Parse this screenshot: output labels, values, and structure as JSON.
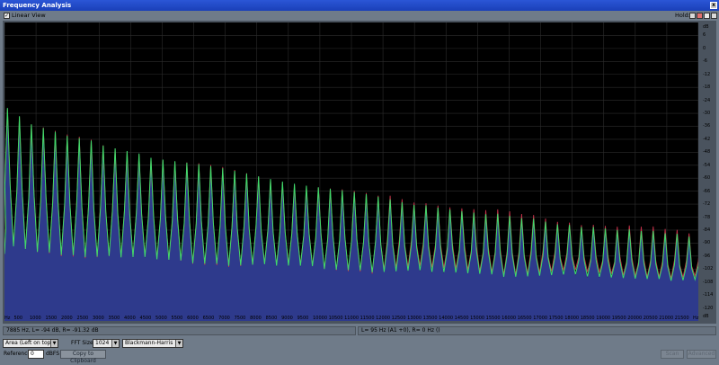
{
  "window": {
    "title": "Frequency Analysis",
    "close_glyph": "x"
  },
  "toolbar": {
    "linear_view_label": "Linear View",
    "linear_view_checked": true,
    "hold_label": "Hold:"
  },
  "hold_buttons": [
    {
      "name": "hold-button-1",
      "color": "#d9d9d9"
    },
    {
      "name": "hold-button-2",
      "color": "#e07070"
    },
    {
      "name": "hold-button-3",
      "color": "#e8e8e8"
    },
    {
      "name": "hold-button-4",
      "color": "#d9d9d9"
    }
  ],
  "status": {
    "left": "7885 Hz, L= -94 dB, R= -91.32 dB",
    "right": "L=     95 Hz (A1 +0), R=     0 Hz ()"
  },
  "controls": {
    "view_mode": "Area (Left on top)",
    "fft_size_label": "FFT Size",
    "fft_size": "1024",
    "window_type": "Blackmann-Harris",
    "reference_label": "Reference",
    "reference_value": "0",
    "reference_unit": "dBFS",
    "copy_button": "Copy to Clipboard",
    "scan_button": "Scan",
    "advanced_button": "Advanced"
  },
  "chart_data": {
    "type": "area",
    "x_ticks": [
      "Hz",
      "500",
      "1000",
      "1500",
      "2000",
      "2500",
      "3000",
      "3500",
      "4000",
      "4500",
      "5000",
      "5500",
      "6000",
      "6500",
      "7000",
      "7500",
      "8000",
      "8500",
      "9000",
      "9500",
      "10000",
      "10500",
      "11000",
      "11500",
      "12000",
      "12500",
      "13000",
      "13500",
      "14000",
      "14500",
      "15000",
      "15500",
      "16000",
      "16500",
      "17000",
      "17500",
      "18000",
      "18500",
      "19000",
      "19500",
      "20000",
      "20500",
      "21000",
      "21500",
      "Hz"
    ],
    "y_ticks": [
      "dB",
      "6",
      "0",
      "-6",
      "-12",
      "-18",
      "-24",
      "-30",
      "-36",
      "-42",
      "-48",
      "-54",
      "-60",
      "-66",
      "-72",
      "-78",
      "-84",
      "-90",
      "-96",
      "-102",
      "-108",
      "-114",
      "-120",
      "dB"
    ],
    "xlim": [
      0,
      22050
    ],
    "ylim": [
      -126,
      12
    ],
    "grid": true,
    "series": [
      {
        "color": "#2e3a8c"
      },
      {
        "color": "#3ddc6a"
      },
      {
        "color": "#c7324a"
      }
    ],
    "fundamental_hz": 95,
    "harmonic_spacing_hz": 380,
    "peaks_db": [
      -27,
      -31,
      -35,
      -37,
      -39,
      -41,
      -42,
      -43,
      -45,
      -46,
      -47,
      -48,
      -50,
      -51,
      -52,
      -53,
      -54,
      -55,
      -56,
      -57,
      -58,
      -59,
      -60,
      -61,
      -62,
      -63,
      -64,
      -65,
      -66,
      -67,
      -68,
      -69,
      -70,
      -71,
      -72,
      -72,
      -73,
      -74,
      -75,
      -76,
      -77,
      -77,
      -78,
      -79,
      -79,
      -80,
      -81,
      -81,
      -82,
      -82,
      -83,
      -84,
      -84,
      -85,
      -85,
      -86,
      -86,
      -87,
      -87,
      -88
    ],
    "valleys_db": [
      -92,
      -93,
      -94,
      -94,
      -95,
      -95,
      -96,
      -96,
      -96,
      -97,
      -97,
      -97,
      -98,
      -98,
      -98,
      -99,
      -99,
      -99,
      -100,
      -100,
      -100,
      -100,
      -101,
      -101,
      -101,
      -101,
      -102,
      -102,
      -102,
      -102,
      -103,
      -103,
      -103,
      -103,
      -103,
      -104,
      -104,
      -104,
      -104,
      -104,
      -104,
      -105,
      -105,
      -105,
      -105,
      -105,
      -105,
      -105,
      -106,
      -106,
      -106,
      -106,
      -106,
      -106,
      -106,
      -107,
      -107,
      -107,
      -107,
      -107
    ]
  }
}
